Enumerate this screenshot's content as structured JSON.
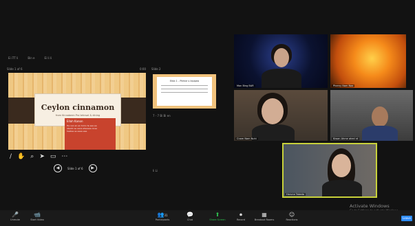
{
  "presenter_bar": {
    "item1": "Ei iTT li",
    "item2": "Bin e",
    "item3": "Ei li li"
  },
  "slide_panel": {
    "header_left": "Slide 1 of 6",
    "header_right": "0:00",
    "title": "Ceylon cinnamon",
    "subtitle": "from Kinnabeen Pro tehnsal & dining",
    "popup_heading": "Ellah Kanon",
    "popup_lines": [
      "Ha nan an en tomo te sea ea",
      "ateatn se eaoe eteeaea onea",
      "hestea se aeea eae"
    ],
    "page_indicator": "Slide 1 of 6"
  },
  "thumb_panel": {
    "header": "Slide 2",
    "thumb_title": "Ekta 1 - Pietne s lepipea",
    "caption": "7 - 7 Bi Bi en",
    "dots": "Ii Li"
  },
  "tiles": [
    {
      "label": "Mon Bing BAR"
    },
    {
      "label": "Pherny Nam Naa"
    },
    {
      "label": "Cnam Nam Nuhi"
    },
    {
      "label": "Kiwan Ahme ahed nt"
    },
    {
      "label": "Haruna Takeda"
    }
  ],
  "watermark": {
    "heading": "Activate Windows",
    "sub": "Go to Settings to activate Windows."
  },
  "toolbar": {
    "mute": "Unmute",
    "video": "Start Video",
    "participants": "Participants",
    "participants_count": "31",
    "chat": "Chat",
    "share": "Share Screen",
    "record": "Record",
    "breakout": "Breakout Rooms",
    "reactions": "Reactions",
    "leave": "Leave"
  }
}
